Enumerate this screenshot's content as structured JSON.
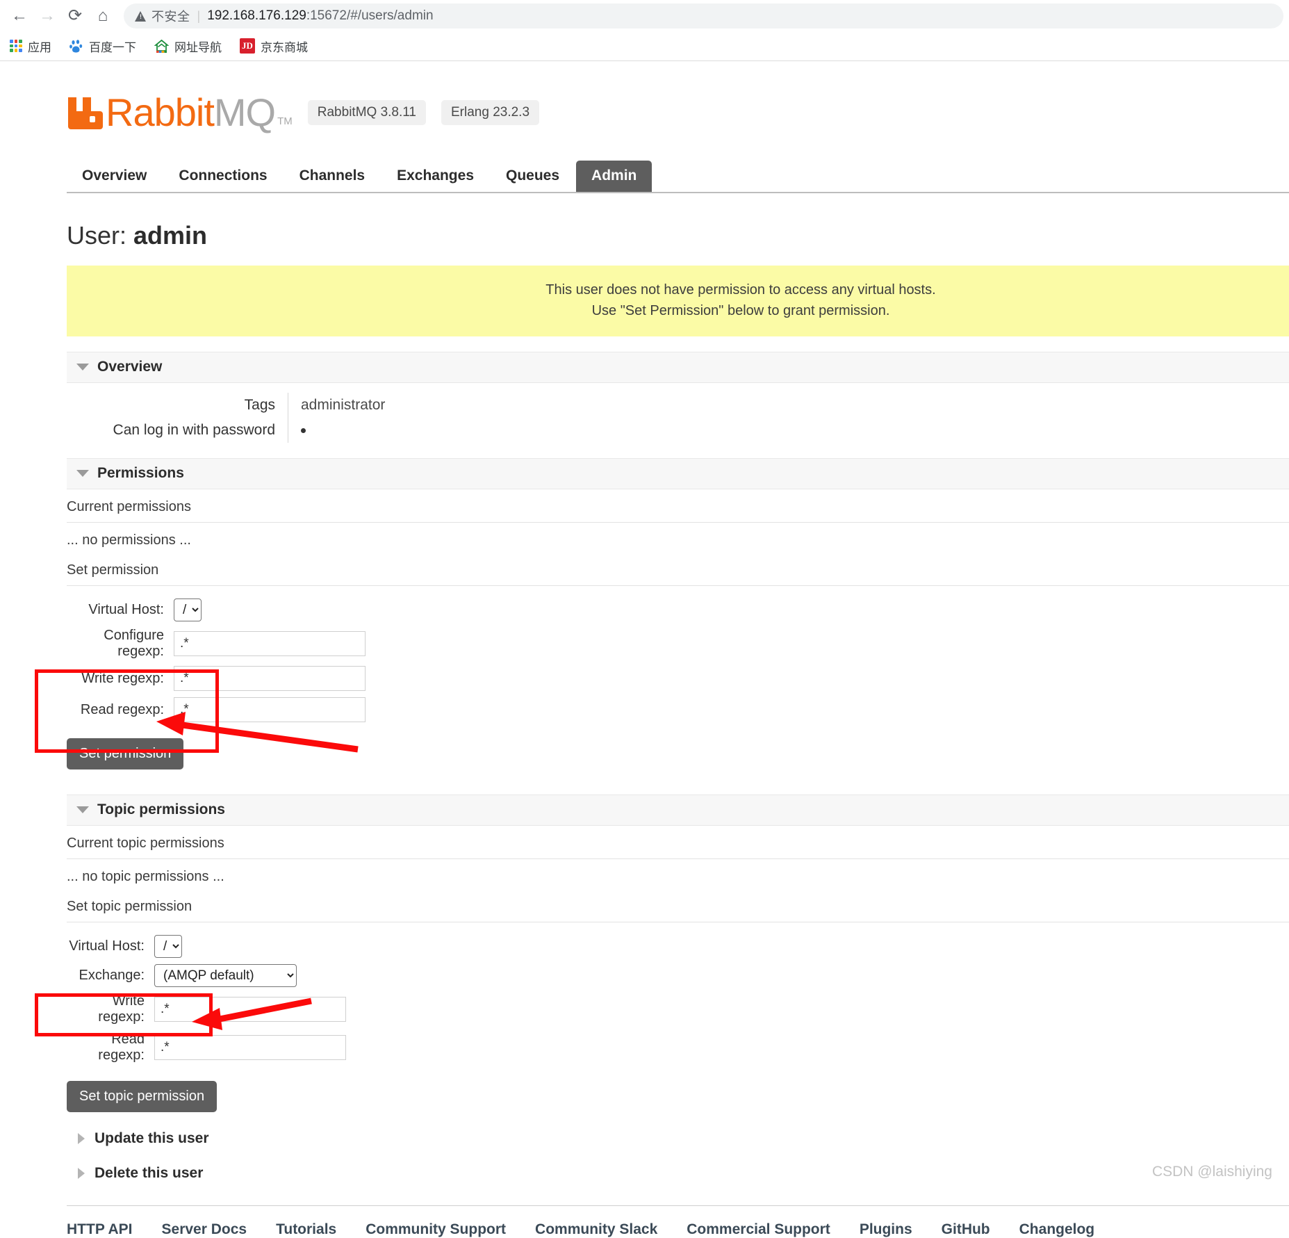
{
  "browser": {
    "back_icon": "arrow-left-icon",
    "forward_icon": "arrow-right-icon",
    "reload_icon": "reload-icon",
    "home_icon": "home-icon",
    "security_label": "不安全",
    "url_host": "192.168.176.129",
    "url_rest": ":15672/#/users/admin",
    "bookmarks": [
      {
        "label": "应用",
        "icon": "apps-grid-icon"
      },
      {
        "label": "百度一下",
        "icon": "baidu-paw-icon"
      },
      {
        "label": "网址导航",
        "icon": "nav2345-icon"
      },
      {
        "label": "京东商城",
        "icon": "jd-icon"
      }
    ]
  },
  "header": {
    "logo_rabbit": "Rabbit",
    "logo_mq": "MQ",
    "trademark": "TM",
    "version_badge": "RabbitMQ 3.8.11",
    "erlang_badge": "Erlang 23.2.3"
  },
  "tabs": [
    {
      "label": "Overview",
      "active": false
    },
    {
      "label": "Connections",
      "active": false
    },
    {
      "label": "Channels",
      "active": false
    },
    {
      "label": "Exchanges",
      "active": false
    },
    {
      "label": "Queues",
      "active": false
    },
    {
      "label": "Admin",
      "active": true
    }
  ],
  "page_title": {
    "label": "User:",
    "value": "admin"
  },
  "banner": {
    "line1": "This user does not have permission to access any virtual hosts.",
    "line2": "Use \"Set Permission\" below to grant permission."
  },
  "overview": {
    "section_title": "Overview",
    "tags_label": "Tags",
    "tags_value": "administrator",
    "password_label": "Can log in with password",
    "password_value": "●"
  },
  "permissions": {
    "section_title": "Permissions",
    "current_label": "Current permissions",
    "current_empty": "... no permissions ...",
    "set_label": "Set permission",
    "vhost_label": "Virtual Host:",
    "vhost_value": "/",
    "configure_label": "Configure regexp:",
    "configure_value": ".*",
    "write_label": "Write regexp:",
    "write_value": ".*",
    "read_label": "Read regexp:",
    "read_value": ".*",
    "submit_label": "Set permission"
  },
  "topic_permissions": {
    "section_title": "Topic permissions",
    "current_label": "Current topic permissions",
    "current_empty": "... no topic permissions ...",
    "set_label": "Set topic permission",
    "vhost_label": "Virtual Host:",
    "vhost_value": "/",
    "exchange_label": "Exchange:",
    "exchange_value": "(AMQP default)",
    "write_label": "Write regexp:",
    "write_value": ".*",
    "read_label": "Read regexp:",
    "read_value": ".*",
    "submit_label": "Set topic permission"
  },
  "collapsed_sections": [
    {
      "label": "Update this user"
    },
    {
      "label": "Delete this user"
    }
  ],
  "footer_links": [
    "HTTP API",
    "Server Docs",
    "Tutorials",
    "Community Support",
    "Community Slack",
    "Commercial Support",
    "Plugins",
    "GitHub",
    "Changelog"
  ],
  "watermark": "CSDN @laishiying",
  "colors": {
    "brand_orange": "#f36a12",
    "annotation_red": "#fb0a0a",
    "banner_yellow": "#fbfba6",
    "button_gray": "#5e5e5e"
  }
}
